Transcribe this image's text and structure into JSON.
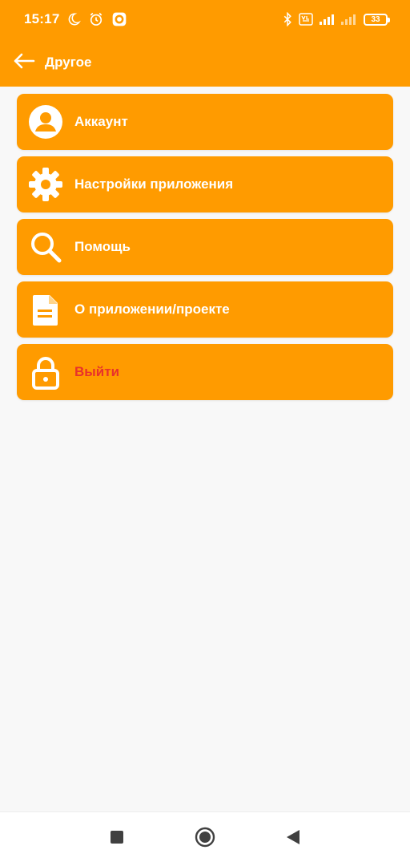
{
  "status_bar": {
    "time": "15:17",
    "battery_level": "33",
    "icons": [
      "moon-icon",
      "alarm-icon",
      "record-icon",
      "bluetooth-icon",
      "volte-icon",
      "signal-icon",
      "signal-icon-secondary",
      "battery-icon"
    ]
  },
  "app_bar": {
    "title": "Другое",
    "back_icon": "arrow-left-icon"
  },
  "menu": {
    "items": [
      {
        "label": "Аккаунт",
        "icon": "account-icon"
      },
      {
        "label": "Настройки приложения",
        "icon": "gear-icon"
      },
      {
        "label": "Помощь",
        "icon": "search-icon"
      },
      {
        "label": "О приложении/проекте",
        "icon": "document-icon"
      },
      {
        "label": "Выйти",
        "icon": "lock-icon",
        "label_color": "#e8322b"
      }
    ]
  },
  "nav_bar": {
    "icons": [
      "recents-icon",
      "home-icon",
      "back-icon"
    ]
  },
  "colors": {
    "accent": "#ff9b00",
    "danger": "#e8322b",
    "background": "#f8f8f8"
  }
}
